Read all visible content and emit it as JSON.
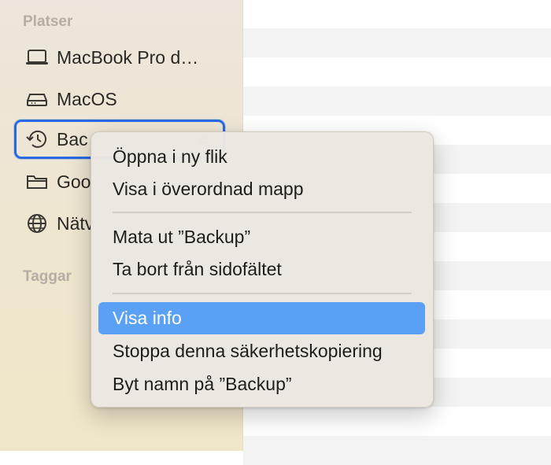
{
  "sidebar": {
    "places_title": "Platser",
    "tags_title": "Taggar",
    "items": [
      {
        "label": "MacBook Pro d…",
        "icon": "laptop-icon"
      },
      {
        "label": "MacOS",
        "icon": "drive-icon"
      },
      {
        "label": "Backup",
        "icon": "time-machine-icon",
        "selected": true,
        "visible_label": "Bac"
      },
      {
        "label": "Goo",
        "icon": "folder-icon"
      },
      {
        "label": "Nätv",
        "icon": "network-icon"
      }
    ]
  },
  "context_menu": {
    "items": [
      {
        "label": "Öppna i ny flik"
      },
      {
        "label": "Visa i överordnad mapp"
      },
      {
        "label": "Mata ut ”Backup”"
      },
      {
        "label": "Ta bort från sidofältet"
      },
      {
        "label": "Visa info",
        "highlighted": true
      },
      {
        "label": "Stoppa denna säkerhetskopiering"
      },
      {
        "label": "Byt namn på ”Backup”"
      }
    ]
  },
  "colors": {
    "accent": "#2a6ae0",
    "highlight": "#5aa0f5"
  }
}
